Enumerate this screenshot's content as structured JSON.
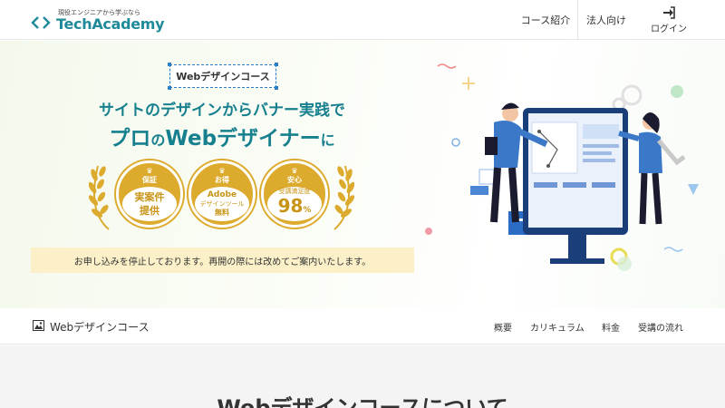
{
  "header": {
    "logo_tagline": "現役エンジニアから学ぶなら",
    "logo_name": "TechAcademy",
    "nav": {
      "course": "コース紹介",
      "corporate": "法人向け",
      "login": "ログイン"
    }
  },
  "hero": {
    "course_badge": "Webデザインコース",
    "title_line1": "サイトのデザインからバナー実践で",
    "title_line2_a": "プロ",
    "title_line2_b": "の",
    "title_line2_c": "Webデザイナー",
    "title_line2_d": "に",
    "medals": [
      {
        "label": "保証",
        "text": "実案件",
        "text2": "提供"
      },
      {
        "label": "お得",
        "text1": "Adobe",
        "text2": "デザインツール",
        "text3": "無料"
      },
      {
        "label": "安心",
        "text1": "受講満足度",
        "value": "98",
        "unit": "%"
      }
    ],
    "notice": "お申し込みを停止しております。再開の際には改めてご案内いたします。"
  },
  "subnav": {
    "title": "Webデザインコース",
    "links": [
      "概要",
      "カリキュラム",
      "料金",
      "受講の流れ"
    ]
  },
  "about": {
    "title": "Webデザインコースについて"
  },
  "colors": {
    "brand_teal": "#17808f",
    "gold": "#dcaa2c",
    "notice_bg": "#fbf0c8"
  }
}
